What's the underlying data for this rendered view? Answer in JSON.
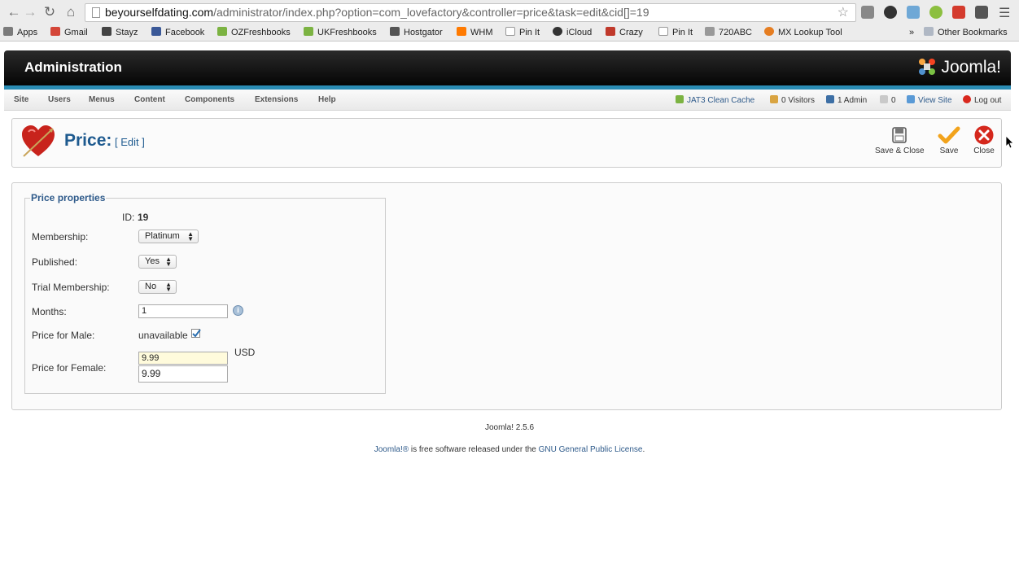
{
  "browser": {
    "url_host": "beyourselfdating.com",
    "url_path": "/administrator/index.php?option=com_lovefactory&controller=price&task=edit&cid[]=19",
    "bookmarks": [
      "Apps",
      "Gmail",
      "Stayz",
      "Facebook",
      "OZFreshbooks",
      "UKFreshbooks",
      "Hostgator",
      "WHM",
      "Pin It",
      "iCloud",
      "Crazy",
      "Pin It",
      "720ABC",
      "MX Lookup Tool"
    ],
    "overflow_chevron": "»",
    "other_bookmarks": "Other Bookmarks"
  },
  "header": {
    "title": "Administration",
    "logo_text": "Joomla!"
  },
  "menu": {
    "items": [
      "Site",
      "Users",
      "Menus",
      "Content",
      "Components",
      "Extensions",
      "Help"
    ]
  },
  "status": {
    "cache": "JAT3 Clean Cache",
    "visitors": "0 Visitors",
    "admins": "1 Admin",
    "messages": "0",
    "view_site": "View Site",
    "logout": "Log out"
  },
  "toolbar": {
    "title": "Price:",
    "subtitle": "[ Edit ]",
    "save_close": "Save & Close",
    "save": "Save",
    "close": "Close"
  },
  "form": {
    "legend": "Price properties",
    "id_label": "ID:",
    "id_value": "19",
    "membership_label": "Membership:",
    "membership_value": "Platinum",
    "published_label": "Published:",
    "published_value": "Yes",
    "trial_label": "Trial Membership:",
    "trial_value": "No",
    "months_label": "Months:",
    "months_value": "1",
    "male_label": "Price for Male:",
    "male_value": "unavailable",
    "male_checked": true,
    "female_label": "Price for Female:",
    "female_value": "9.99",
    "female_value_2": "9.99",
    "currency": "USD"
  },
  "footer": {
    "version": "Joomla! 2.5.6",
    "license_prefix": "Joomla!®",
    "license_text": " is free software released under the ",
    "license_link": "GNU General Public License",
    "license_suffix": "."
  },
  "colors": {
    "accent_blue": "#2a8cb4",
    "title_blue": "#1e5a8f",
    "header_black": "#050505"
  }
}
